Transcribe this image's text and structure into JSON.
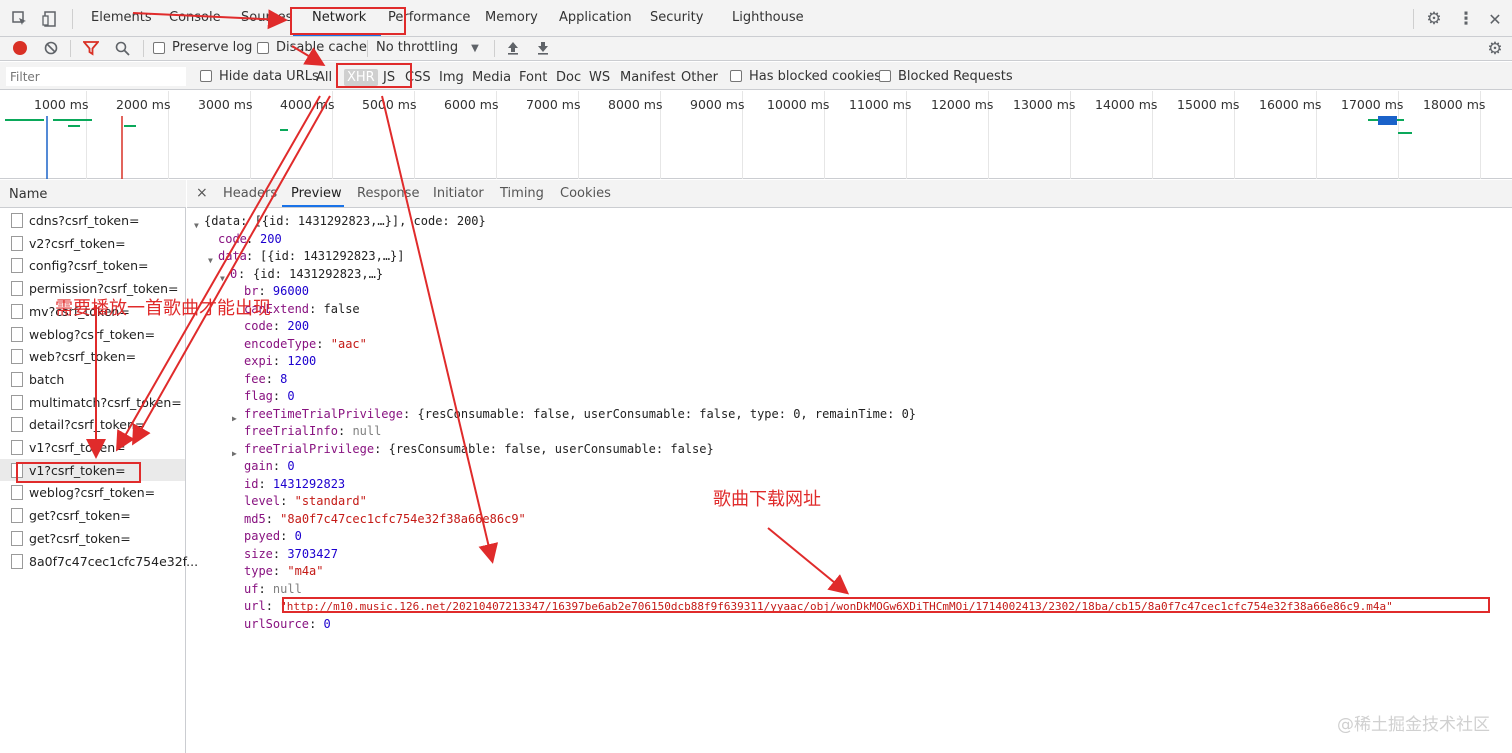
{
  "tabbar": {
    "tabs": [
      "Elements",
      "Console",
      "Sources",
      "Network",
      "Performance",
      "Memory",
      "Application",
      "Security",
      "Lighthouse"
    ],
    "active": "Network"
  },
  "toolbar": {
    "preserve_log": "Preserve log",
    "disable_cache": "Disable cache",
    "throttling": "No throttling"
  },
  "filterbar": {
    "placeholder": "Filter",
    "hide_data_urls": "Hide data URLs",
    "types": [
      "All",
      "XHR",
      "JS",
      "CSS",
      "Img",
      "Media",
      "Font",
      "Doc",
      "WS",
      "Manifest",
      "Other"
    ],
    "selected_type": "XHR",
    "has_blocked_cookies": "Has blocked cookies",
    "blocked_requests": "Blocked Requests"
  },
  "overview": {
    "ticks": [
      "1000 ms",
      "2000 ms",
      "3000 ms",
      "4000 ms",
      "5000 ms",
      "6000 ms",
      "7000 ms",
      "8000 ms",
      "9000 ms",
      "10000 ms",
      "11000 ms",
      "12000 ms",
      "13000 ms",
      "14000 ms",
      "15000 ms",
      "16000 ms",
      "17000 ms",
      "18000 ms"
    ]
  },
  "requests": {
    "header": "Name",
    "items": [
      "cdns?csrf_token=",
      "v2?csrf_token=",
      "config?csrf_token=",
      "permission?csrf_token=",
      "mv?csrf_token=",
      "weblog?csrf_token=",
      "web?csrf_token=",
      "batch",
      "multimatch?csrf_token=",
      "detail?csrf_token=",
      "v1?csrf_token=",
      "v1?csrf_token=",
      "weblog?csrf_token=",
      "get?csrf_token=",
      "get?csrf_token=",
      "8a0f7c47cec1cfc754e32f..."
    ],
    "selected_index": 11
  },
  "detail": {
    "close": "×",
    "tabs": [
      "Headers",
      "Preview",
      "Response",
      "Initiator",
      "Timing",
      "Cookies"
    ],
    "active": "Preview"
  },
  "preview": {
    "root": "{data: [{id: 1431292823,…}], code: 200}",
    "code_key": "code",
    "code_val": "200",
    "data_key": "data",
    "data_val": "[{id: 1431292823,…}]",
    "item_key": "0",
    "item_val": "{id: 1431292823,…}",
    "fields": [
      {
        "k": "br",
        "v": "96000",
        "t": "n"
      },
      {
        "k": "canExtend",
        "v": "false",
        "t": "kw"
      },
      {
        "k": "code",
        "v": "200",
        "t": "n"
      },
      {
        "k": "encodeType",
        "v": "\"aac\"",
        "t": "s"
      },
      {
        "k": "expi",
        "v": "1200",
        "t": "n"
      },
      {
        "k": "fee",
        "v": "8",
        "t": "n"
      },
      {
        "k": "flag",
        "v": "0",
        "t": "n"
      },
      {
        "k": "freeTimeTrialPrivilege",
        "v": "{resConsumable: false, userConsumable: false, type: 0, remainTime: 0}",
        "t": "kw",
        "expand": true
      },
      {
        "k": "freeTrialInfo",
        "v": "null",
        "t": "nul"
      },
      {
        "k": "freeTrialPrivilege",
        "v": "{resConsumable: false, userConsumable: false}",
        "t": "kw",
        "expand": true
      },
      {
        "k": "gain",
        "v": "0",
        "t": "n"
      },
      {
        "k": "id",
        "v": "1431292823",
        "t": "n"
      },
      {
        "k": "level",
        "v": "\"standard\"",
        "t": "s"
      },
      {
        "k": "md5",
        "v": "\"8a0f7c47cec1cfc754e32f38a66e86c9\"",
        "t": "s"
      },
      {
        "k": "payed",
        "v": "0",
        "t": "n"
      },
      {
        "k": "size",
        "v": "3703427",
        "t": "n"
      },
      {
        "k": "type",
        "v": "\"m4a\"",
        "t": "s"
      },
      {
        "k": "uf",
        "v": "null",
        "t": "nul"
      },
      {
        "k": "url",
        "v": "\"http://m10.music.126.net/20210407213347/16397be6ab2e706150dcb88f9f639311/yyaac/obj/wonDkMOGw6XDiTHCmMOi/1714002413/2302/18ba/cb15/8a0f7c47cec1cfc754e32f38a66e86c9.m4a\"",
        "t": "s"
      },
      {
        "k": "urlSource",
        "v": "0",
        "t": "n"
      }
    ]
  },
  "annotations": {
    "play_note": "需要播放一首歌曲才能出现",
    "url_note": "歌曲下载网址",
    "color": "#e02b2b"
  },
  "watermark": "@稀土掘金技术社区"
}
